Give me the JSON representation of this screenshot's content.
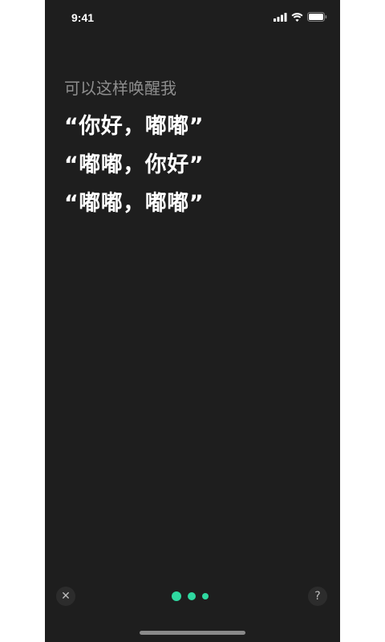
{
  "status_bar": {
    "time": "9:41",
    "icons": [
      "signal-icon",
      "wifi-icon",
      "battery-icon"
    ]
  },
  "main": {
    "hint": "可以这样唤醒我",
    "phrases": [
      "“你好，嘟嘟”",
      "“嘟嘟，你好”",
      "“嘟嘟，嘟嘟”"
    ]
  },
  "bottom": {
    "close_glyph": "✕",
    "help_glyph": "?",
    "page_dots": 3
  },
  "colors": {
    "background": "#1e1e1e",
    "hint_text": "#8e8e8e",
    "phrase_text": "#ffffff",
    "accent": "#2fd8a0"
  }
}
